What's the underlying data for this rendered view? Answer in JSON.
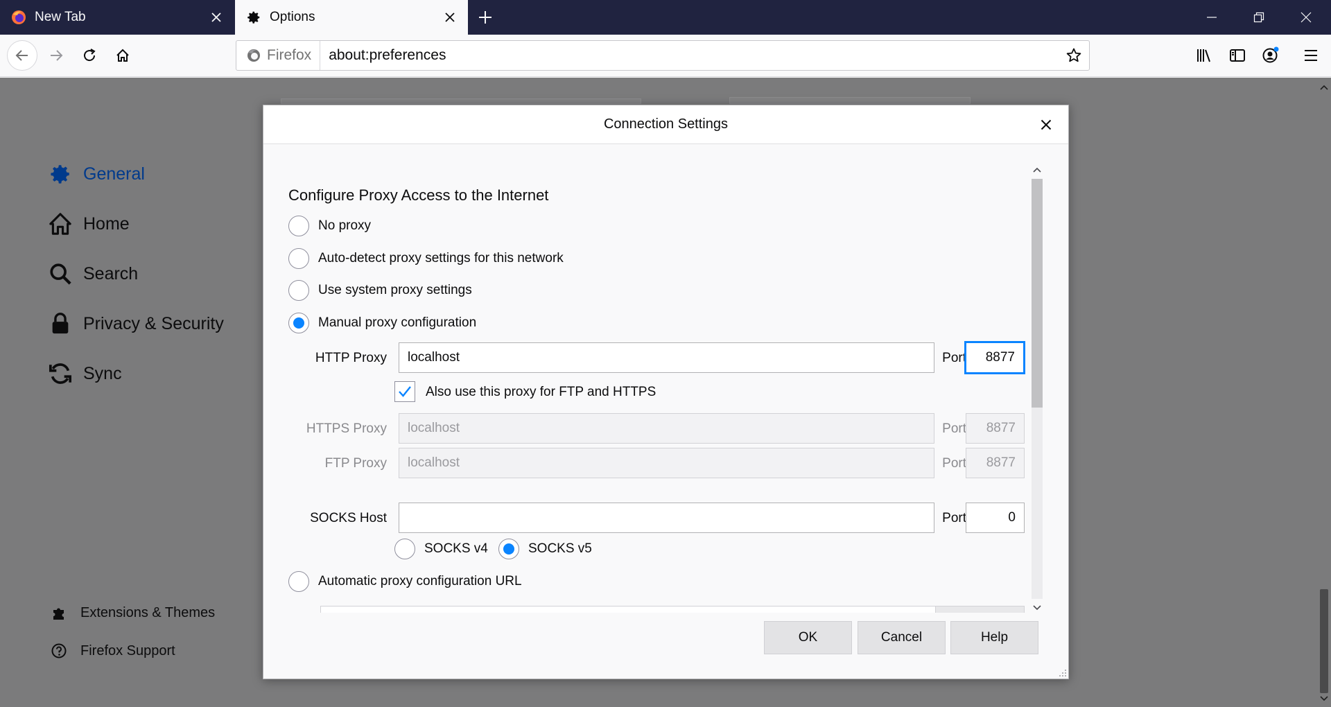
{
  "browser": {
    "tabs": [
      {
        "title": "New Tab",
        "icon": "firefox-logo-icon",
        "active": false
      },
      {
        "title": "Options",
        "icon": "gear-icon",
        "active": true
      }
    ],
    "identity_label": "Firefox",
    "url": "about:preferences"
  },
  "sidebar": {
    "items": [
      {
        "label": "General",
        "icon": "gear-icon",
        "selected": true
      },
      {
        "label": "Home",
        "icon": "home-icon",
        "selected": false
      },
      {
        "label": "Search",
        "icon": "search-icon",
        "selected": false
      },
      {
        "label": "Privacy & Security",
        "icon": "lock-icon",
        "selected": false
      },
      {
        "label": "Sync",
        "icon": "sync-icon",
        "selected": false
      }
    ],
    "footer": [
      {
        "label": "Extensions & Themes",
        "icon": "puzzle-icon"
      },
      {
        "label": "Firefox Support",
        "icon": "help-icon"
      }
    ]
  },
  "dialog": {
    "title": "Connection Settings",
    "section_heading": "Configure Proxy Access to the Internet",
    "options": {
      "no_proxy": "No proxy",
      "auto_detect": "Auto-detect proxy settings for this network",
      "system": "Use system proxy settings",
      "manual": "Manual proxy configuration",
      "auto_url": "Automatic proxy configuration URL"
    },
    "selected_option": "manual",
    "http": {
      "label": "HTTP Proxy",
      "value": "localhost",
      "port_label": "Port",
      "port": "8877"
    },
    "share_checkbox": {
      "label": "Also use this proxy for FTP and HTTPS",
      "checked": true
    },
    "https": {
      "label": "HTTPS Proxy",
      "value": "localhost",
      "port_label": "Port",
      "port": "8877"
    },
    "ftp": {
      "label": "FTP Proxy",
      "value": "localhost",
      "port_label": "Port",
      "port": "8877"
    },
    "socks": {
      "label": "SOCKS Host",
      "value": "",
      "port_label": "Port",
      "port": "0",
      "v4_label": "SOCKS v4",
      "v5_label": "SOCKS v5",
      "selected_version": "v5"
    },
    "buttons": {
      "ok": "OK",
      "cancel": "Cancel",
      "help": "Help"
    }
  },
  "colors": {
    "accent": "#0a84ff",
    "tabstrip": "#202340",
    "selected_nav": "#003a8c"
  }
}
